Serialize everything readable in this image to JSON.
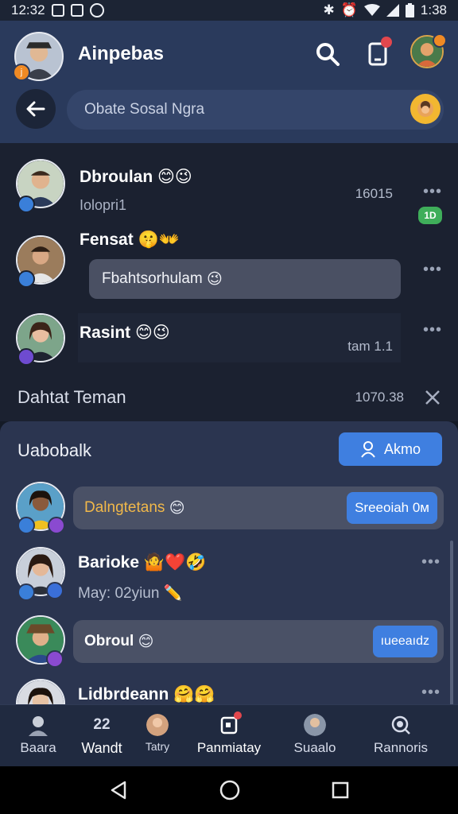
{
  "status_bar": {
    "time_left": "12:32",
    "time_right": "1:38"
  },
  "header": {
    "app_title": "Ainpebas",
    "me_badge": "j",
    "search_placeholder": "Obate Sosal Ngra",
    "icons": [
      "search-icon",
      "tablet-icon",
      "profile-avatar",
      "back-arrow-icon",
      "emoji-face-icon"
    ]
  },
  "chats": [
    {
      "name": "Dbroulan",
      "emoji": "😊😉",
      "sub": "Iolopri1",
      "time": "16015"
    },
    {
      "name": "Fensat",
      "emoji": "🤫👐",
      "bubble": "Fbahtsorhulam",
      "bubble_emoji": "😉",
      "chip": "1D"
    },
    {
      "name": "Rasint",
      "emoji": "😊😉",
      "time": "tam 1.1"
    }
  ],
  "section": {
    "title": "Dahtat Teman",
    "time": "1070.38"
  },
  "friends_panel": {
    "title": "Uabobalk",
    "add_button": "Akmo",
    "items": [
      {
        "name": "Dalngtetans",
        "emoji": "😊",
        "pill": "Sreeoiah 0м"
      },
      {
        "name": "Barioke",
        "emoji": "🤷❤️🤣",
        "sub": "May: 02yiun",
        "sub_emoji": "✏️"
      },
      {
        "name": "Obroul",
        "emoji": "😊",
        "pill": "ıueeaıdz"
      },
      {
        "name": "Lidbrdeann",
        "emoji": "🤗🤗"
      }
    ]
  },
  "bottom_nav": [
    {
      "label": "Baara"
    },
    {
      "label": "Wandt",
      "icon_text": "22"
    },
    {
      "label": "Tatry"
    },
    {
      "label": "Panmiatay"
    },
    {
      "label": "Suaalo"
    },
    {
      "label": "Rannoris"
    }
  ],
  "colors": {
    "accent": "#3f7fe0",
    "header": "#2a3a5c",
    "panel": "#2b3550",
    "badge_orange": "#f08a24",
    "alert_red": "#e2474d"
  }
}
